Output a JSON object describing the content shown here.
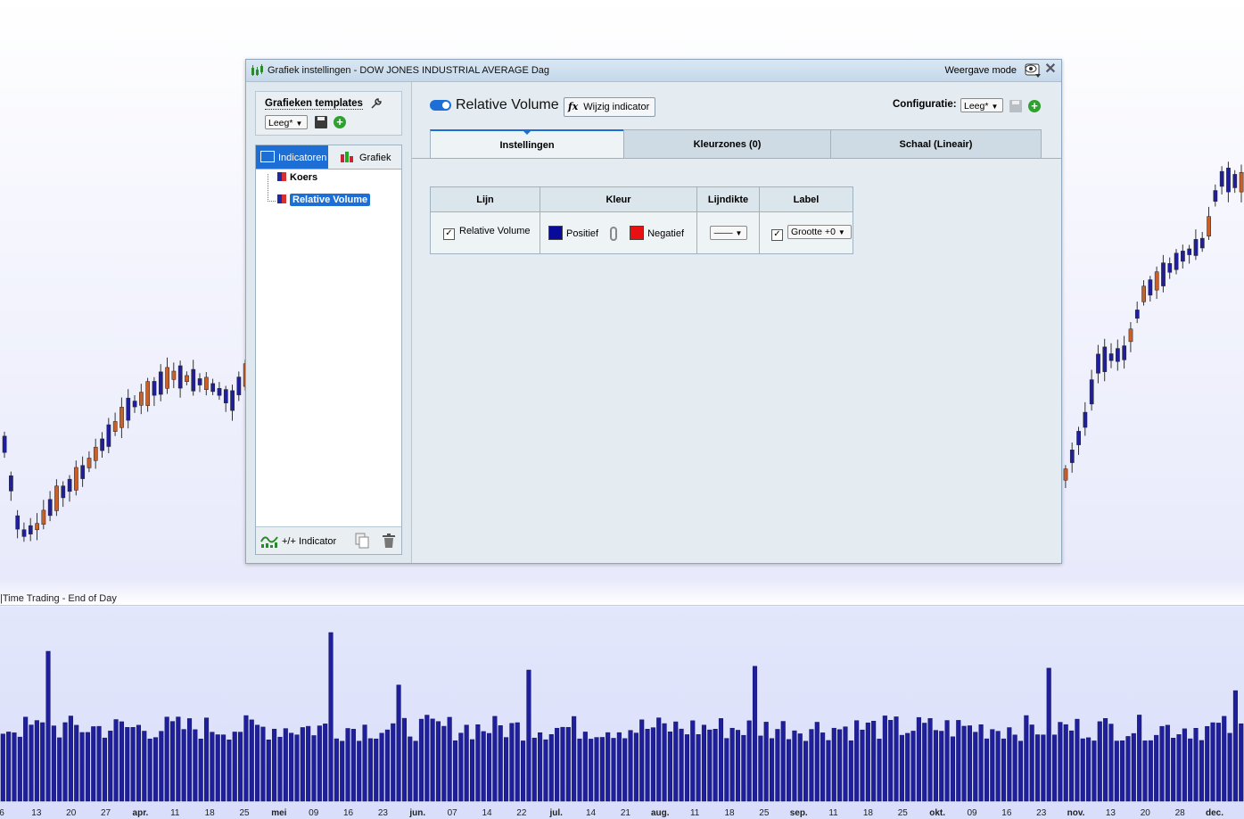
{
  "dialog": {
    "title": "Grafiek instellingen - DOW JONES INDUSTRIAL AVERAGE Dag",
    "mode_label": "Weergave mode",
    "close_icon": "close-icon"
  },
  "templates": {
    "label": "Grafieken templates",
    "select_value": "Leeg*"
  },
  "indicator_tabs": {
    "indicators": "Indicatoren",
    "chart": "Grafiek"
  },
  "tree": {
    "items": [
      {
        "label": "Koers"
      },
      {
        "label": "Relative Volume"
      }
    ]
  },
  "footer": {
    "add_label": "+/+ Indicator"
  },
  "indicator": {
    "title": "Relative Volume",
    "change_button": "Wijzig indicator",
    "fx_glyph": "fx",
    "config_label": "Configuratie:",
    "config_value": "Leeg*"
  },
  "settings_tabs": [
    {
      "label": "Instellingen"
    },
    {
      "label": "Kleurzones (0)"
    },
    {
      "label": "Schaal (Lineair)"
    }
  ],
  "grid": {
    "headers": [
      "Lijn",
      "Kleur",
      "Lijndikte",
      "Label"
    ],
    "row": {
      "line_name": "Relative Volume",
      "positive_label": "Positief",
      "positive_color": "#0a0a9a",
      "negative_label": "Negatief",
      "negative_color": "#e81010",
      "line_width": "——",
      "label_size": "Grootte +0"
    }
  },
  "chart": {
    "volume_caption": "|Time Trading - End of Day",
    "bull_color": "#1f1f9c",
    "bear_color": "#c8602a",
    "x_ticks": [
      {
        "label": "6",
        "month": false
      },
      {
        "label": "13",
        "month": false
      },
      {
        "label": "20",
        "month": false
      },
      {
        "label": "27",
        "month": false
      },
      {
        "label": "apr.",
        "month": true
      },
      {
        "label": "11",
        "month": false
      },
      {
        "label": "18",
        "month": false
      },
      {
        "label": "25",
        "month": false
      },
      {
        "label": "mei",
        "month": true
      },
      {
        "label": "09",
        "month": false
      },
      {
        "label": "16",
        "month": false
      },
      {
        "label": "23",
        "month": false
      },
      {
        "label": "jun.",
        "month": true
      },
      {
        "label": "07",
        "month": false
      },
      {
        "label": "14",
        "month": false
      },
      {
        "label": "22",
        "month": false
      },
      {
        "label": "jul.",
        "month": true
      },
      {
        "label": "14",
        "month": false
      },
      {
        "label": "21",
        "month": false
      },
      {
        "label": "aug.",
        "month": true
      },
      {
        "label": "11",
        "month": false
      },
      {
        "label": "18",
        "month": false
      },
      {
        "label": "25",
        "month": false
      },
      {
        "label": "sep.",
        "month": true
      },
      {
        "label": "11",
        "month": false
      },
      {
        "label": "18",
        "month": false
      },
      {
        "label": "25",
        "month": false
      },
      {
        "label": "okt.",
        "month": true
      },
      {
        "label": "09",
        "month": false
      },
      {
        "label": "16",
        "month": false
      },
      {
        "label": "23",
        "month": false
      },
      {
        "label": "nov.",
        "month": true
      },
      {
        "label": "13",
        "month": false
      },
      {
        "label": "20",
        "month": false
      },
      {
        "label": "28",
        "month": false
      },
      {
        "label": "dec.",
        "month": true
      }
    ]
  }
}
